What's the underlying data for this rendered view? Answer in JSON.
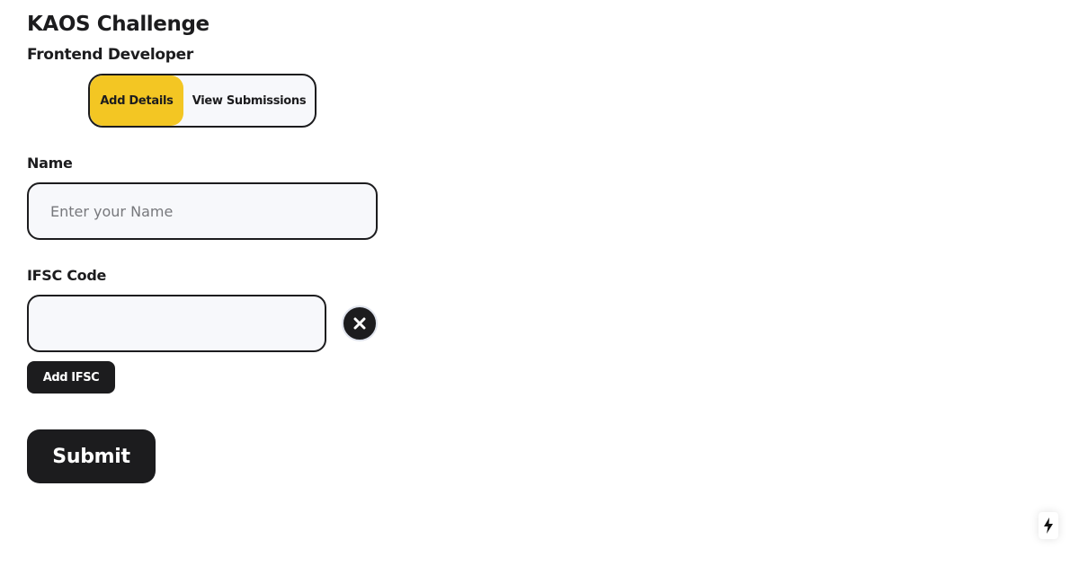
{
  "header": {
    "title": "KAOS Challenge",
    "subtitle": "Frontend Developer"
  },
  "tabs": [
    {
      "label": "Add Details",
      "active": true
    },
    {
      "label": "View Submissions",
      "active": false
    }
  ],
  "form": {
    "name": {
      "label": "Name",
      "placeholder": "Enter your Name",
      "value": ""
    },
    "ifsc": {
      "label": "IFSC Code",
      "value": "",
      "remove_icon": "close-icon"
    },
    "add_ifsc_label": "Add IFSC",
    "submit_label": "Submit"
  },
  "corner_icon": "lightning-icon",
  "colors": {
    "accent": "#f3c623",
    "dark": "#1c1c1e",
    "input_bg": "#f7f8fb"
  }
}
